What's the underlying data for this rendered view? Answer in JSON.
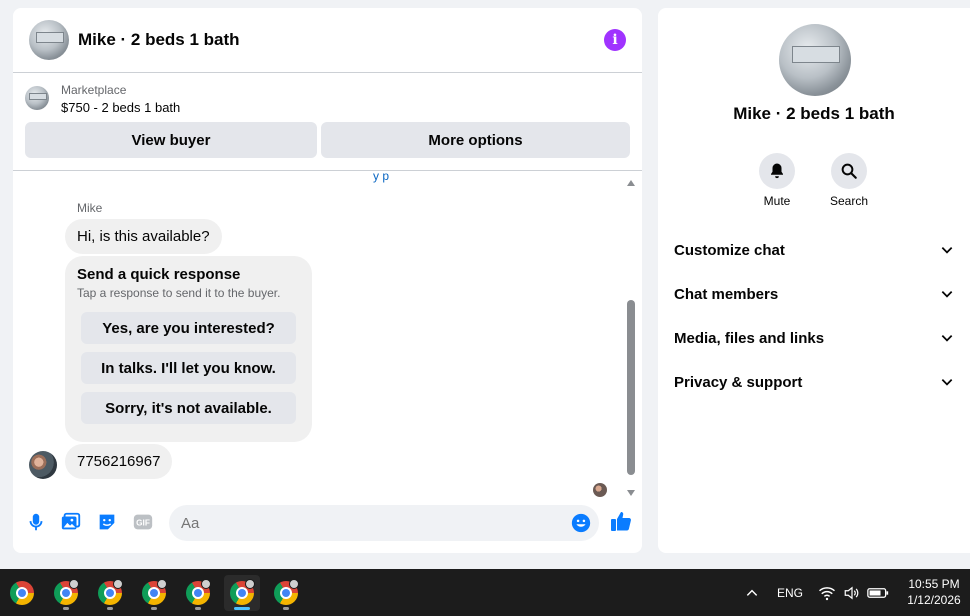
{
  "chat": {
    "title": "Mike · 2 beds 1 bath",
    "listing": {
      "source": "Marketplace",
      "price_title": "$750 - 2 beds 1 bath",
      "view_buyer_label": "View buyer",
      "more_options_label": "More options"
    },
    "top_partial_text": "y p",
    "sender_name": "Mike",
    "messages": [
      {
        "text": "Hi, is this available?"
      },
      {
        "text": "7756216967"
      }
    ],
    "quick_response": {
      "title": "Send a quick response",
      "subtitle": "Tap a response to send it to the buyer.",
      "options": [
        "Yes, are you interested?",
        "In talks. I'll let you know.",
        "Sorry, it's not available."
      ]
    },
    "composer": {
      "placeholder": "Aa",
      "icons": [
        "microphone-icon",
        "photo-icon",
        "sticker-icon",
        "gif-icon",
        "emoji-icon",
        "thumbs-up-icon"
      ],
      "gif_label": "GIF"
    }
  },
  "side": {
    "title": "Mike · 2 beds 1 bath",
    "actions": [
      {
        "label": "Mute",
        "icon": "bell-icon"
      },
      {
        "label": "Search",
        "icon": "search-icon"
      }
    ],
    "menu": [
      "Customize chat",
      "Chat members",
      "Media, files and links",
      "Privacy & support"
    ]
  },
  "taskbar": {
    "language": "ENG",
    "time": "10:55 PM",
    "date": "1/12/2026"
  },
  "colors": {
    "accent": "#0a7cff",
    "info_purple": "#a033ff",
    "bubble_grey": "#f0f0f0",
    "button_grey": "#e4e6eb"
  }
}
